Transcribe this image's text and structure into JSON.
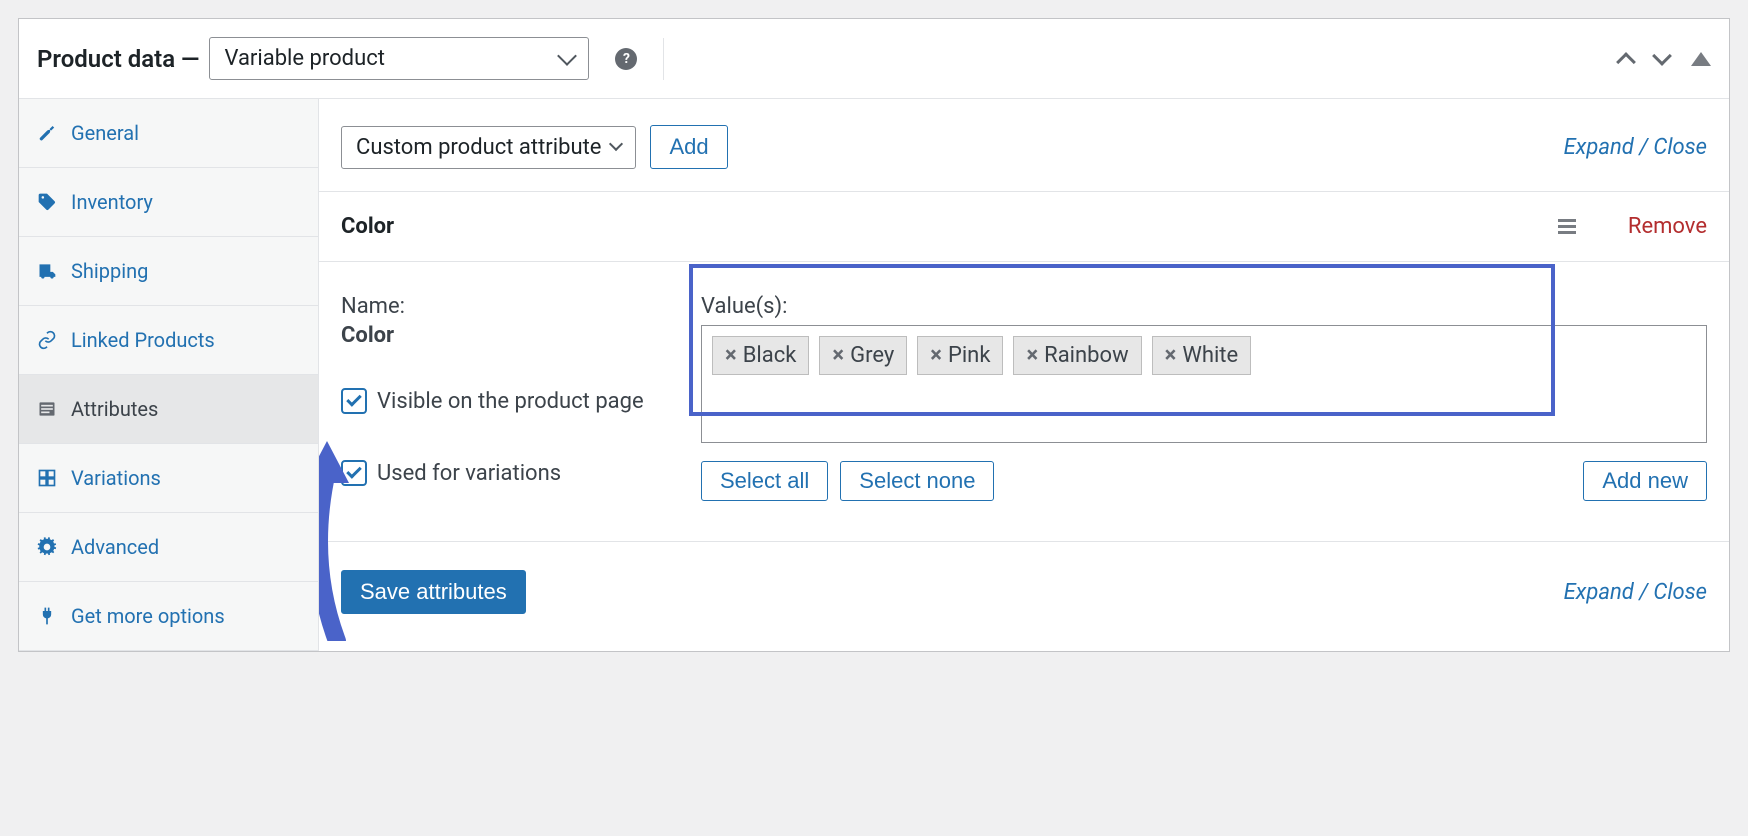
{
  "header": {
    "title": "Product data —",
    "product_type": "Variable product"
  },
  "sidebar": {
    "tabs": [
      {
        "id": "general",
        "label": "General"
      },
      {
        "id": "inventory",
        "label": "Inventory"
      },
      {
        "id": "shipping",
        "label": "Shipping"
      },
      {
        "id": "linked",
        "label": "Linked Products"
      },
      {
        "id": "attributes",
        "label": "Attributes"
      },
      {
        "id": "variations",
        "label": "Variations"
      },
      {
        "id": "advanced",
        "label": "Advanced"
      },
      {
        "id": "getmore",
        "label": "Get more options"
      }
    ]
  },
  "attributes_panel": {
    "attribute_type_selector": "Custom product attribute",
    "add_button": "Add",
    "expand_close": "Expand / Close",
    "attribute": {
      "title": "Color",
      "name_label": "Name:",
      "name_value": "Color",
      "visible_label": "Visible on the product page",
      "used_for_variations_label": "Used for variations",
      "values_label": "Value(s):",
      "values": [
        "Black",
        "Grey",
        "Pink",
        "Rainbow",
        "White"
      ],
      "select_all": "Select all",
      "select_none": "Select none",
      "add_new": "Add new",
      "remove": "Remove"
    },
    "save_button": "Save attributes",
    "bottom_expand_close": "Expand / Close"
  }
}
